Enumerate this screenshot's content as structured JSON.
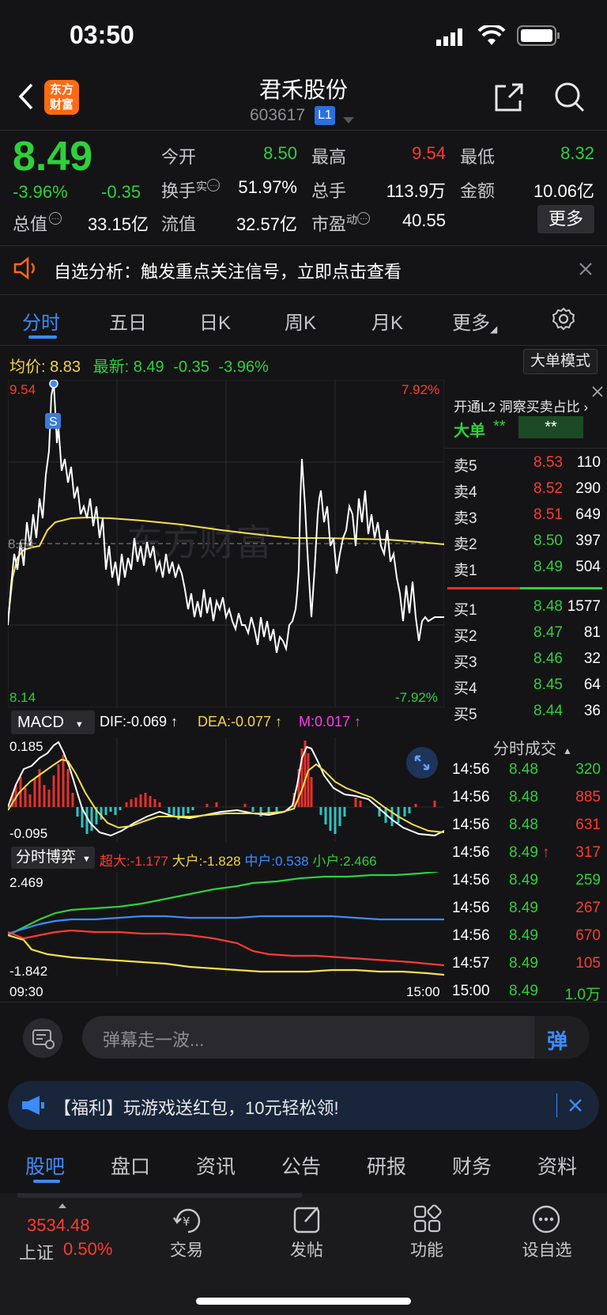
{
  "status": {
    "time": "03:50"
  },
  "header": {
    "title": "君禾股份",
    "code": "603617",
    "level": "L1",
    "logo_line1": "东方",
    "logo_line2": "财富"
  },
  "quote": {
    "price": "8.49",
    "change_pct": "-3.96%",
    "change": "-0.35",
    "open_label": "今开",
    "open": "8.50",
    "high_label": "最高",
    "high": "9.54",
    "low_label": "最低",
    "low": "8.32",
    "turnover_label": "换手",
    "turnover_sup": "实",
    "turnover": "51.97%",
    "volume_label": "总手",
    "volume": "113.9万",
    "amount_label": "金额",
    "amount": "10.06亿",
    "mktcap_label": "总值",
    "mktcap": "33.15亿",
    "float_label": "流值",
    "float": "32.57亿",
    "pe_label": "市盈",
    "pe_sup": "动",
    "pe": "40.55",
    "more_button": "更多"
  },
  "notice": {
    "text": "自选分析：触发重点关注信号，立即点击查看"
  },
  "tabs": [
    "分时",
    "五日",
    "日K",
    "周K",
    "月K",
    "更多"
  ],
  "avg_bar": {
    "avg_label": "均价:",
    "avg": "8.83",
    "latest_label": "最新:",
    "latest": "8.49",
    "chg": "-0.35",
    "pct": "-3.96%",
    "big_mode": "大单模式"
  },
  "intraday": {
    "y_max": "9.54",
    "y_min": "8.14",
    "y_mid": "8.84",
    "pct_max": "7.92%",
    "pct_min": "-7.92%",
    "watermark": "东方财富",
    "marker": "S",
    "colors": {
      "price": "#ffffff",
      "avg": "#f4e04d"
    }
  },
  "l2": {
    "promo": "开通L2 洞察买卖占比",
    "big_label": "大单",
    "stars1": "**",
    "stars2": "**"
  },
  "orderbook": {
    "asks": [
      {
        "label": "卖5",
        "price": "8.53",
        "vol": "110"
      },
      {
        "label": "卖4",
        "price": "8.52",
        "vol": "290"
      },
      {
        "label": "卖3",
        "price": "8.51",
        "vol": "649"
      },
      {
        "label": "卖2",
        "price": "8.50",
        "vol": "397"
      },
      {
        "label": "卖1",
        "price": "8.49",
        "vol": "504"
      }
    ],
    "bids": [
      {
        "label": "买1",
        "price": "8.48",
        "vol": "1577"
      },
      {
        "label": "买2",
        "price": "8.47",
        "vol": "81"
      },
      {
        "label": "买3",
        "price": "8.46",
        "vol": "32"
      },
      {
        "label": "买4",
        "price": "8.45",
        "vol": "64"
      },
      {
        "label": "买5",
        "price": "8.44",
        "vol": "36"
      }
    ]
  },
  "ticks_title": "分时成交",
  "ticks": [
    {
      "time": "14:56",
      "price": "8.48",
      "vol": "320",
      "dir": "green"
    },
    {
      "time": "14:56",
      "price": "8.48",
      "vol": "885",
      "dir": "red"
    },
    {
      "time": "14:56",
      "price": "8.48",
      "vol": "631",
      "dir": "red"
    },
    {
      "time": "14:56",
      "price": "8.49",
      "arrow": "↑",
      "vol": "317",
      "dir": "red"
    },
    {
      "time": "14:56",
      "price": "8.49",
      "vol": "259",
      "dir": "green"
    },
    {
      "time": "14:56",
      "price": "8.49",
      "vol": "267",
      "dir": "red"
    },
    {
      "time": "14:56",
      "price": "8.49",
      "vol": "670",
      "dir": "red"
    },
    {
      "time": "14:57",
      "price": "8.49",
      "vol": "105",
      "dir": "red"
    },
    {
      "time": "15:00",
      "price": "8.49",
      "vol": "1.0万",
      "dir": "green"
    }
  ],
  "macd": {
    "selector": "MACD",
    "dif": "DIF:-0.069 ↑",
    "dea": "DEA:-0.077 ↑",
    "m": "M:0.017 ↑",
    "y_max": "0.185",
    "y_min": "-0.095"
  },
  "bo": {
    "selector": "分时博弈",
    "super": "超大:-1.177",
    "big": "大户:-1.828",
    "mid": "中户:0.538",
    "small": "小户:2.466",
    "y_max": "2.469",
    "y_min": "-1.842",
    "x_start": "09:30",
    "x_end": "15:00"
  },
  "comment": {
    "placeholder": "弹幕走一波..."
  },
  "promo": {
    "text": "【福利】玩游戏送红包，10元轻松领!"
  },
  "bottom_tabs": [
    "股吧",
    "盘口",
    "资讯",
    "公告",
    "研报",
    "财务",
    "资料"
  ],
  "nav": {
    "index_value": "3534.48",
    "index_name": "上证",
    "index_pct": "0.50%",
    "items": [
      "交易",
      "发帖",
      "功能",
      "设自选"
    ]
  }
}
